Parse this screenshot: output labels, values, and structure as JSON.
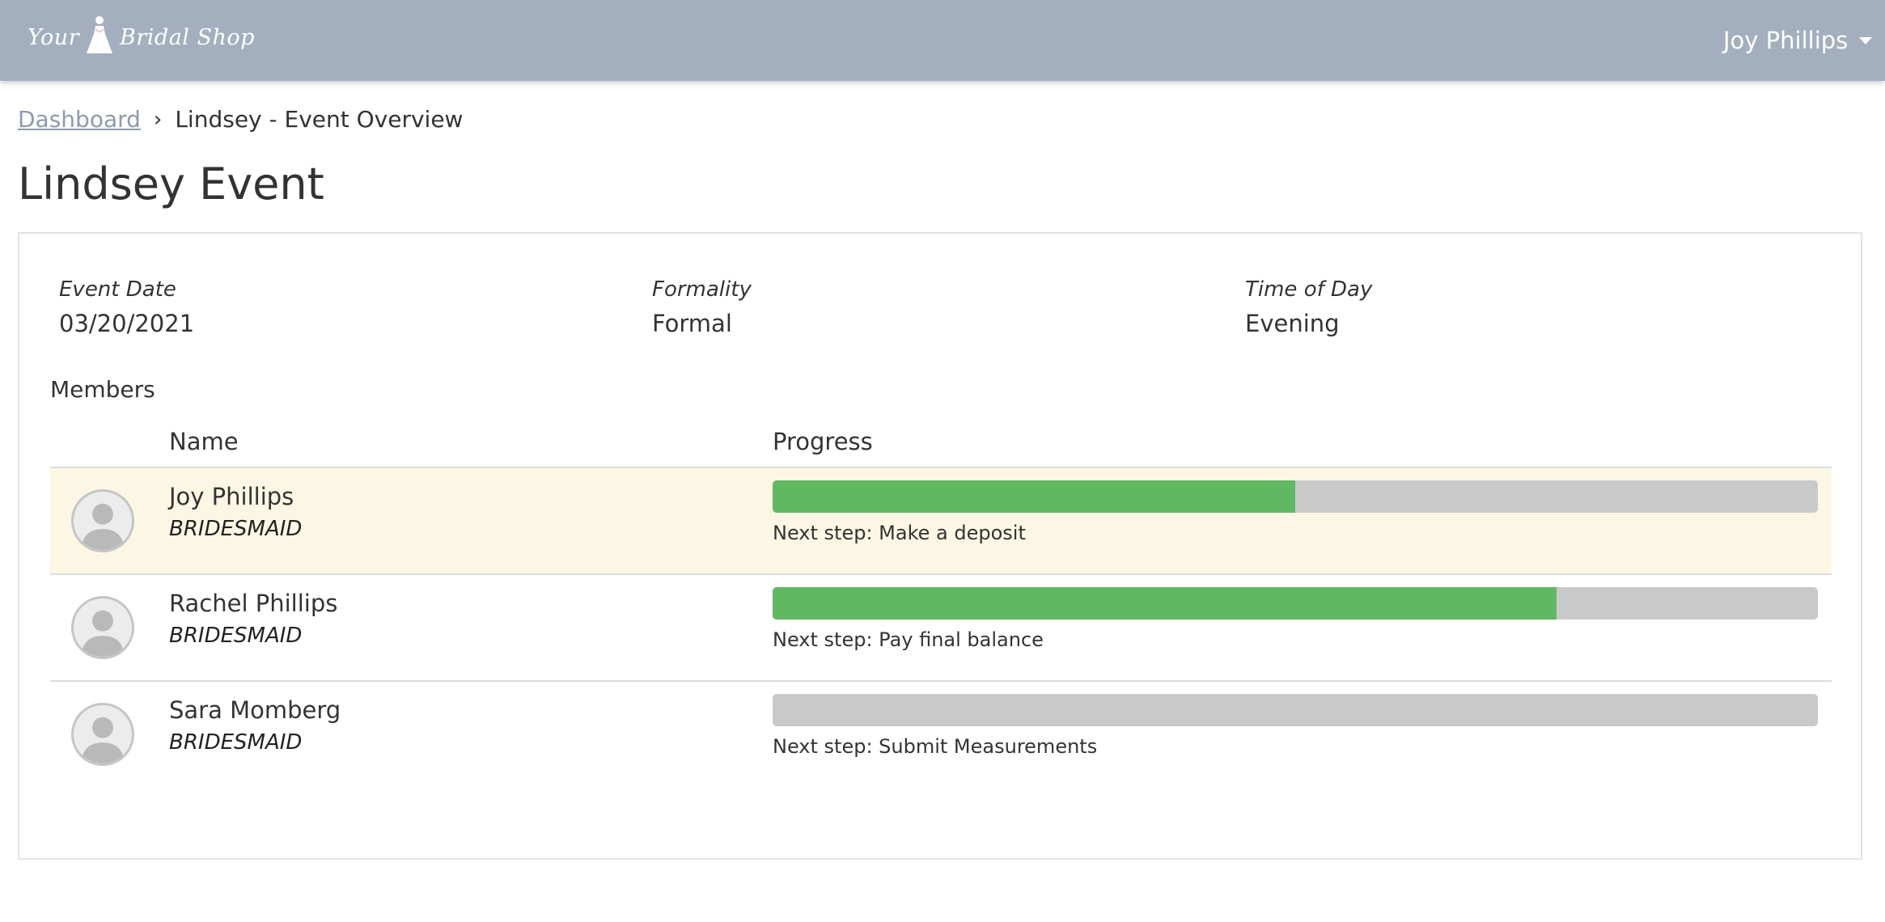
{
  "header": {
    "logo_text_left": "Your",
    "logo_text_right": "Bridal Shop",
    "user_name": "Joy Phillips"
  },
  "breadcrumb": {
    "link": "Dashboard",
    "separator": "›",
    "current": "Lindsey - Event Overview"
  },
  "page_title": "Lindsey Event",
  "event_info": {
    "date_label": "Event Date",
    "date_value": "03/20/2021",
    "formality_label": "Formality",
    "formality_value": "Formal",
    "time_label": "Time of Day",
    "time_value": "Evening"
  },
  "members": {
    "heading": "Members",
    "columns": {
      "name": "Name",
      "progress": "Progress"
    },
    "rows": [
      {
        "name": "Joy Phillips",
        "role": "BRIDESMAID",
        "progress": 0.5,
        "next_step": "Next step: Make a deposit",
        "highlight": true
      },
      {
        "name": "Rachel Phillips",
        "role": "BRIDESMAID",
        "progress": 0.75,
        "next_step": "Next step: Pay final balance",
        "highlight": false
      },
      {
        "name": "Sara Momberg",
        "role": "BRIDESMAID",
        "progress": 0,
        "next_step": "Next step: Submit Measurements",
        "highlight": false
      }
    ]
  },
  "colors": {
    "header_bg": "#a3afbe",
    "progress_fill": "#61b862",
    "progress_track": "#c9c9c9",
    "highlight_row": "#fcf7e4",
    "link": "#8e9bac"
  },
  "icons": {
    "logo": "dress-icon",
    "user_menu": "caret-down-icon",
    "avatar": "user-avatar-icon"
  }
}
